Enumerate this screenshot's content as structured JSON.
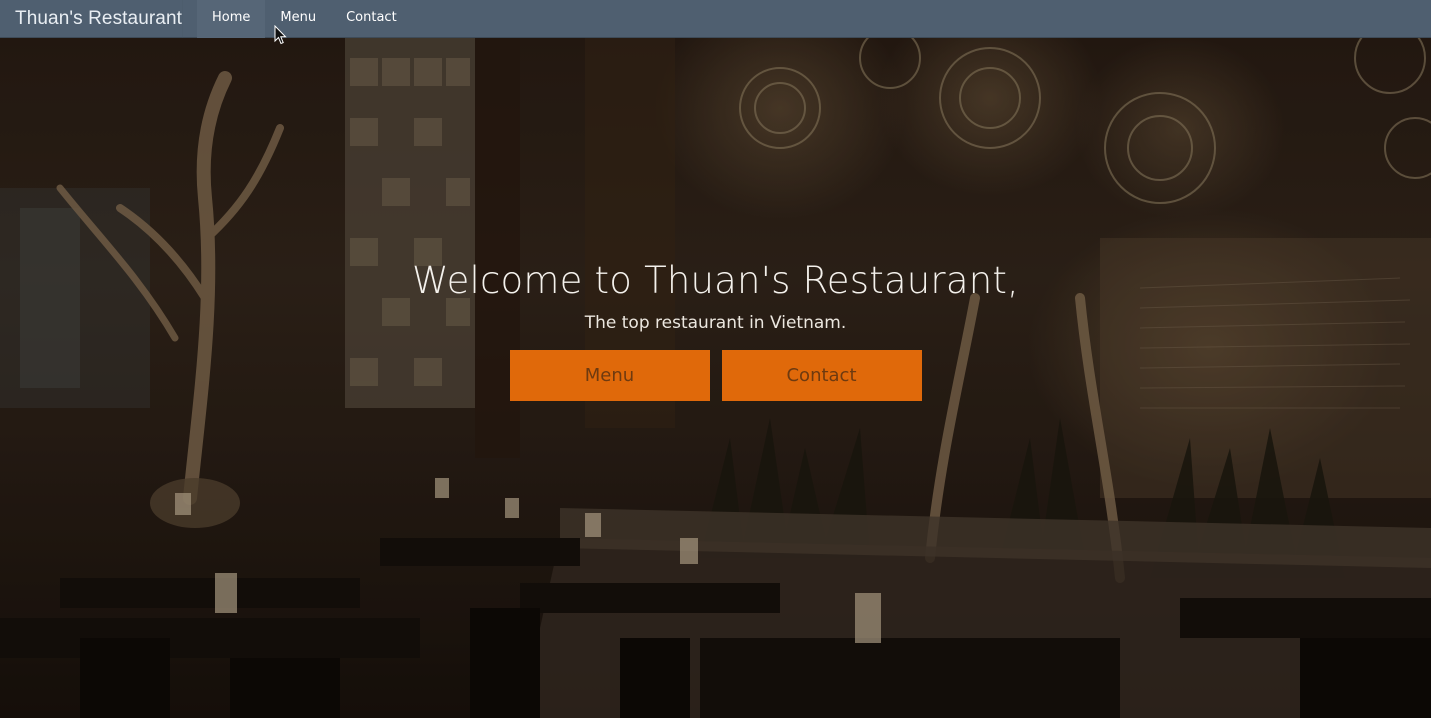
{
  "navbar": {
    "brand": "Thuan's Restaurant",
    "links": [
      {
        "label": "Home"
      },
      {
        "label": "Menu"
      },
      {
        "label": "Contact"
      }
    ]
  },
  "hero": {
    "title": "Welcome to Thuan's Restaurant,",
    "subtitle": "The top restaurant in Vietnam.",
    "buttons": [
      {
        "label": "Menu"
      },
      {
        "label": "Contact"
      }
    ]
  },
  "colors": {
    "navbar_bg": "#4f5f70",
    "button_bg": "#e0690a",
    "button_text": "#6e3a10"
  },
  "icons": [
    "mouse-cursor-icon"
  ]
}
